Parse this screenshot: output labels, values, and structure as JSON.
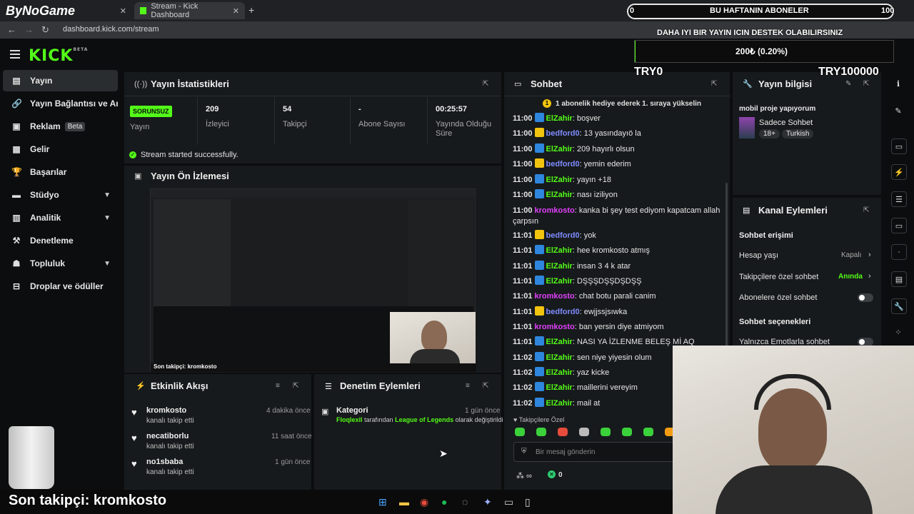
{
  "browser": {
    "tabs": [
      {
        "label": "ByNoGame"
      },
      {
        "label": "Stream - Kick Dashboard"
      }
    ],
    "url": "dashboard.kick.com/stream"
  },
  "brand": {
    "logo": "KICK",
    "logo_sup": "BETA"
  },
  "sidebar": {
    "items": [
      {
        "label": "Yayın",
        "icon": "broadcast-icon"
      },
      {
        "label": "Yayın Bağlantısı ve Anahtarı",
        "icon": "link-icon"
      },
      {
        "label": "Reklam",
        "icon": "ad-icon",
        "badge": "Beta"
      },
      {
        "label": "Gelir",
        "icon": "revenue-icon"
      },
      {
        "label": "Başarılar",
        "icon": "trophy-icon"
      },
      {
        "label": "Stüdyo",
        "icon": "studio-icon"
      },
      {
        "label": "Analitik",
        "icon": "analytics-icon"
      },
      {
        "label": "Denetleme",
        "icon": "moderation-icon"
      },
      {
        "label": "Topluluk",
        "icon": "community-icon"
      },
      {
        "label": "Droplar ve ödüller",
        "icon": "drops-icon"
      }
    ]
  },
  "stats": {
    "title": "Yayın İstatistikleri",
    "status_badge": "SORUNSUZ",
    "status_label": "Yayın",
    "viewers": {
      "value": "209",
      "label": "İzleyici"
    },
    "followers": {
      "value": "54",
      "label": "Takipçi"
    },
    "subs": {
      "value": "-",
      "label": "Abone Sayısı"
    },
    "uptime": {
      "value": "00:25:57",
      "label": "Yayında Olduğu Süre"
    },
    "success_msg": "Stream started successfully."
  },
  "preview": {
    "title": "Yayın Ön İzlemesi",
    "caption": "Son takipçi: kromkosto"
  },
  "chat": {
    "title": "Sohbet",
    "pinned": "1 abonelik hediye ederek 1. sıraya yükselin",
    "messages": [
      {
        "time": "11:00",
        "user": "ElZahir",
        "badge": "mod",
        "color": "#53fc18",
        "text": "boşver"
      },
      {
        "time": "11:00",
        "user": "bedford0",
        "badge": "sub",
        "color": "#7e8cff",
        "text": "13 yasındayıö la"
      },
      {
        "time": "11:00",
        "user": "ElZahir",
        "badge": "mod",
        "color": "#53fc18",
        "text": "209 hayırlı olsun"
      },
      {
        "time": "11:00",
        "user": "bedford0",
        "badge": "sub",
        "color": "#7e8cff",
        "text": "yemin ederim"
      },
      {
        "time": "11:00",
        "user": "ElZahir",
        "badge": "mod",
        "color": "#53fc18",
        "text": "yayın +18"
      },
      {
        "time": "11:00",
        "user": "ElZahir",
        "badge": "mod",
        "color": "#53fc18",
        "text": "nası iziliyon"
      },
      {
        "time": "11:00",
        "user": "kromkosto",
        "badge": "",
        "color": "#e040fb",
        "text": "kanka bi şey test ediyom kapatcam allah"
      },
      {
        "time": "",
        "user": "",
        "badge": "",
        "color": "#e6e6e6",
        "text": "çarpsın"
      },
      {
        "time": "11:01",
        "user": "bedford0",
        "badge": "sub",
        "color": "#7e8cff",
        "text": "yok"
      },
      {
        "time": "11:01",
        "user": "ElZahir",
        "badge": "mod",
        "color": "#53fc18",
        "text": "hee kromkosto atmış"
      },
      {
        "time": "11:01",
        "user": "ElZahir",
        "badge": "mod",
        "color": "#53fc18",
        "text": "insan 3 4 k atar"
      },
      {
        "time": "11:01",
        "user": "ElZahir",
        "badge": "mod",
        "color": "#53fc18",
        "text": "DŞŞŞDŞŞDŞDŞŞ"
      },
      {
        "time": "11:01",
        "user": "kromkosto",
        "badge": "",
        "color": "#e040fb",
        "text": "chat botu parali canim"
      },
      {
        "time": "11:01",
        "user": "bedford0",
        "badge": "sub",
        "color": "#7e8cff",
        "text": "ewjjssjsıwka"
      },
      {
        "time": "11:01",
        "user": "kromkosto",
        "badge": "",
        "color": "#e040fb",
        "text": "ban yersin diye atmiyom"
      },
      {
        "time": "11:01",
        "user": "ElZahir",
        "badge": "mod",
        "color": "#53fc18",
        "text": "NASI YA İZLENME BELEŞ Mİ AQ"
      },
      {
        "time": "11:02",
        "user": "ElZahir",
        "badge": "mod",
        "color": "#53fc18",
        "text": "sen niye yiyesin olum"
      },
      {
        "time": "11:02",
        "user": "ElZahir",
        "badge": "mod",
        "color": "#53fc18",
        "text": "yaz kicke"
      },
      {
        "time": "11:02",
        "user": "ElZahir",
        "badge": "mod",
        "color": "#53fc18",
        "text": "maillerini vereyim"
      },
      {
        "time": "11:02",
        "user": "ElZahir",
        "badge": "mod",
        "color": "#53fc18",
        "text": "mail at"
      }
    ],
    "followers_only": "Takipçilere Özel",
    "input_placeholder": "Bir mesaj gönderin",
    "footer_count": "0"
  },
  "activity": {
    "title": "Etkinlik Akışı",
    "items": [
      {
        "name": "kromkosto",
        "sub": "kanalı takip etti",
        "time": "4 dakika önce"
      },
      {
        "name": "necatiborlu",
        "sub": "kanalı takip etti",
        "time": "11 saat önce"
      },
      {
        "name": "no1sbaba",
        "sub": "kanalı takip etti",
        "time": "1 gün önce"
      }
    ]
  },
  "moderation": {
    "title": "Denetim Eylemleri",
    "item": {
      "label": "Kategori",
      "time": "1 gün önce",
      "user": "Floqlexil",
      "mid": "tarafından",
      "target": "League of Legends",
      "end": "olarak değiştirildi"
    }
  },
  "streaminfo": {
    "title": "Yayın bilgisi",
    "stream_title": "mobil proje yapıyorum",
    "category": "Sadece Sohbet",
    "tags": [
      "18+",
      "Turkish"
    ]
  },
  "channel": {
    "title": "Kanal Eylemleri",
    "chat_access": "Sohbet erişimi",
    "account_age": {
      "label": "Hesap yaşı",
      "value": "Kapalı"
    },
    "followers_chat": {
      "label": "Takipçilere özel sohbet",
      "value": "Anında"
    },
    "subs_chat": {
      "label": "Abonelere özel sohbet"
    },
    "chat_options": "Sohbet seçenekleri",
    "emote_only": {
      "label": "Yalnızca Emotlarla sohbet"
    }
  },
  "overlay": {
    "sub_left": "0",
    "sub_title": "BU HAFTANIN ABONELER",
    "sub_right": "100",
    "donate_line": "DAHA IYI BIR YAYIN ICIN DESTEK OLABILIRSINIZ",
    "donate_amount": "200₺ (0.20%)",
    "try_left": "TRY0",
    "try_right": "TRY100000",
    "bottom_caption": "Son takipçi: kromkosto"
  },
  "colors": {
    "accent": "#53fc18",
    "panel": "#171a1c",
    "bg": "#0b0d0e"
  }
}
